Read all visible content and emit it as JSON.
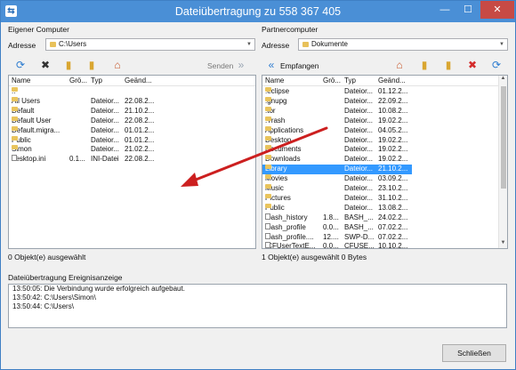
{
  "window": {
    "title": "Dateiübertragung zu 558 367 405",
    "min_icon": "minimize-icon",
    "max_icon": "maximize-icon",
    "close_icon": "close-icon"
  },
  "local": {
    "section_label": "Eigener Computer",
    "address_label": "Adresse",
    "address_value": "C:\\Users",
    "send_label": "Senden",
    "columns": [
      "Name",
      "Grö...",
      "Typ",
      "Geänd..."
    ],
    "rows": [
      {
        "name": "..",
        "size": "",
        "type": "",
        "date": "",
        "icon": "folder-icon"
      },
      {
        "name": "All Users",
        "size": "",
        "type": "Dateior...",
        "date": "22.08.2...",
        "icon": "folder-icon"
      },
      {
        "name": "Default",
        "size": "",
        "type": "Dateior...",
        "date": "21.10.2...",
        "icon": "folder-icon"
      },
      {
        "name": "Default User",
        "size": "",
        "type": "Dateior...",
        "date": "22.08.2...",
        "icon": "folder-icon"
      },
      {
        "name": "Default.migra...",
        "size": "",
        "type": "Dateior...",
        "date": "01.01.2...",
        "icon": "folder-icon"
      },
      {
        "name": "Public",
        "size": "",
        "type": "Dateior...",
        "date": "01.01.2...",
        "icon": "folder-icon"
      },
      {
        "name": "Simon",
        "size": "",
        "type": "Dateior...",
        "date": "21.02.2...",
        "icon": "folder-icon"
      },
      {
        "name": "desktop.ini",
        "size": "0.1...",
        "type": "INI-Datei",
        "date": "22.08.2...",
        "icon": "settings-file-icon"
      }
    ],
    "status": "0 Objekt(e) ausgewählt"
  },
  "remote": {
    "section_label": "Partnercomputer",
    "address_label": "Adresse",
    "address_value": "Dokumente",
    "receive_label": "Empfangen",
    "columns": [
      "Name",
      "Grö...",
      "Typ",
      "Geänd..."
    ],
    "rows": [
      {
        "name": ".eclipse",
        "size": "",
        "type": "Dateior...",
        "date": "01.12.2...",
        "icon": "folder-icon"
      },
      {
        "name": ".gnupg",
        "size": "",
        "type": "Dateior...",
        "date": "22.09.2...",
        "icon": "folder-icon"
      },
      {
        "name": ".tor",
        "size": "",
        "type": "Dateior...",
        "date": "10.08.2...",
        "icon": "folder-icon"
      },
      {
        "name": ".Trash",
        "size": "",
        "type": "Dateior...",
        "date": "19.02.2...",
        "icon": "folder-icon"
      },
      {
        "name": "Applications",
        "size": "",
        "type": "Dateior...",
        "date": "04.05.2...",
        "icon": "folder-icon"
      },
      {
        "name": "Desktop",
        "size": "",
        "type": "Dateior...",
        "date": "19.02.2...",
        "icon": "folder-icon"
      },
      {
        "name": "Documents",
        "size": "",
        "type": "Dateior...",
        "date": "19.02.2...",
        "icon": "folder-icon"
      },
      {
        "name": "Downloads",
        "size": "",
        "type": "Dateior...",
        "date": "19.02.2...",
        "icon": "folder-icon"
      },
      {
        "name": "Library",
        "size": "",
        "type": "Dateior...",
        "date": "21.10.2...",
        "icon": "folder-icon",
        "selected": true
      },
      {
        "name": "Movies",
        "size": "",
        "type": "Dateior...",
        "date": "03.09.2...",
        "icon": "folder-icon"
      },
      {
        "name": "Music",
        "size": "",
        "type": "Dateior...",
        "date": "23.10.2...",
        "icon": "folder-icon"
      },
      {
        "name": "Pictures",
        "size": "",
        "type": "Dateior...",
        "date": "31.10.2...",
        "icon": "folder-icon"
      },
      {
        "name": "Public",
        "size": "",
        "type": "Dateior...",
        "date": "13.08.2...",
        "icon": "folder-icon"
      },
      {
        "name": ".bash_history",
        "size": "1.8...",
        "type": "BASH_...",
        "date": "24.02.2...",
        "icon": "file-icon"
      },
      {
        "name": ".bash_profile",
        "size": "0.0...",
        "type": "BASH_...",
        "date": "07.02.2...",
        "icon": "file-icon"
      },
      {
        "name": ".bash_profile....",
        "size": "12....",
        "type": "SWP-D...",
        "date": "07.02.2...",
        "icon": "file-icon"
      },
      {
        "name": ".CFUserTextE...",
        "size": "0.0...",
        "type": "CFUSE...",
        "date": "10.10.2...",
        "icon": "file-icon"
      }
    ],
    "status": "1 Objekt(e) ausgewählt  0 Bytes"
  },
  "log": {
    "label": "Dateiübertragung Ereignisanzeige",
    "entries": [
      "13:50:05: Die Verbindung wurde erfolgreich aufgebaut.",
      "13:50:42: C:\\Users\\Simon\\",
      "13:50:44: C:\\Users\\"
    ]
  },
  "close_button_label": "Schließen",
  "accent_color": "#4a8fd6",
  "arrow_color": "#cc1f1f"
}
